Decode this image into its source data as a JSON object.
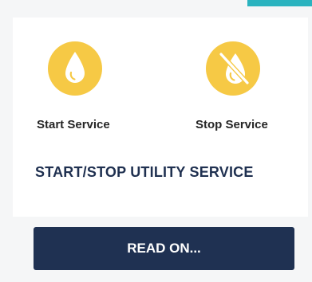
{
  "services": [
    {
      "label": "Start Service",
      "icon": "water-drop-icon"
    },
    {
      "label": "Stop Service",
      "icon": "no-water-icon"
    }
  ],
  "card": {
    "title": "START/STOP UTILITY SERVICE",
    "button_label": "READ ON..."
  },
  "colors": {
    "accent": "#2ab3bf",
    "icon_circle": "#f6c945",
    "title": "#1f3050",
    "button": "#1f3152"
  }
}
